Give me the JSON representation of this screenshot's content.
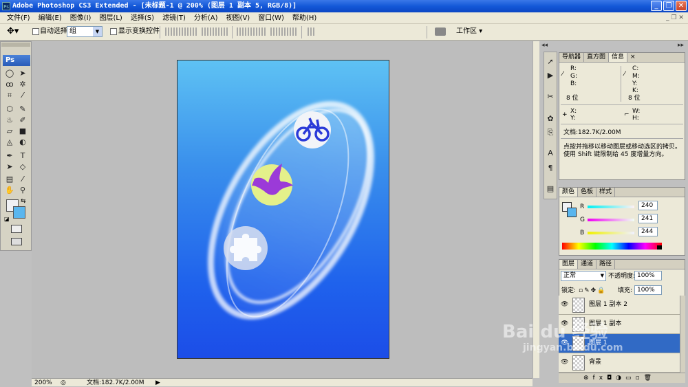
{
  "window": {
    "title": "Adobe Photoshop CS3 Extended - [未标题-1 @ 200% (图层 1 副本 5, RGB/8)]",
    "app_icon": "Ps",
    "min_icon": "minimize-icon",
    "max_icon": "restore-icon",
    "close_icon": "close-icon"
  },
  "menu": [
    "文件(F)",
    "编辑(E)",
    "图像(I)",
    "图层(L)",
    "选择(S)",
    "滤镜(T)",
    "分析(A)",
    "视图(V)",
    "窗口(W)",
    "帮助(H)"
  ],
  "options": {
    "auto_select_label": "自动选择:",
    "auto_select_value": "组",
    "show_transform_label": "显示变换控件",
    "workspace_label": "工作区 ▾"
  },
  "toolbox": {
    "badge": "Ps"
  },
  "status": {
    "zoom": "200%",
    "doc": "文档:182.7K/2.00M"
  },
  "info_panel": {
    "tabs": [
      "导航器",
      "直方图",
      "信息"
    ],
    "active_tab": "信息",
    "rgb": [
      "R:",
      "G:",
      "B:"
    ],
    "cmyk": [
      "C:",
      "M:",
      "Y:",
      "K:"
    ],
    "bit_left": "8 位",
    "bit_right": "8 位",
    "xy": [
      "X:",
      "Y:"
    ],
    "wh": [
      "W:",
      "H:"
    ],
    "doc": "文档:182.7K/2.00M",
    "hint_line1": "点按并拖移以移动图层或移动选区的拷贝。",
    "hint_line2": "使用 Shift 键限制给 45 度增量方向。"
  },
  "color_panel": {
    "tabs": [
      "颜色",
      "色板",
      "样式"
    ],
    "channels": [
      "R",
      "G",
      "B"
    ],
    "values": [
      "240",
      "241",
      "244"
    ]
  },
  "layers_panel": {
    "tabs": [
      "图层",
      "通道",
      "路径"
    ],
    "blend_mode": "正常",
    "opacity_label": "不透明度:",
    "opacity_value": "100%",
    "lock_label": "锁定:",
    "fill_label": "填充:",
    "fill_value": "100%",
    "layers": [
      {
        "name": "图层 1 副本 2"
      },
      {
        "name": "图层 1 副本"
      },
      {
        "name": "图层 1"
      },
      {
        "name": "背景"
      }
    ]
  },
  "watermark": {
    "line1": "Bai du 经验",
    "line2": "jingyan.baidu.com"
  },
  "colors": {
    "titlebar": "#1458d8",
    "canvas_top": "#5ec2f4",
    "canvas_bottom": "#1c4de8",
    "selected_layer": "#316ac5"
  }
}
